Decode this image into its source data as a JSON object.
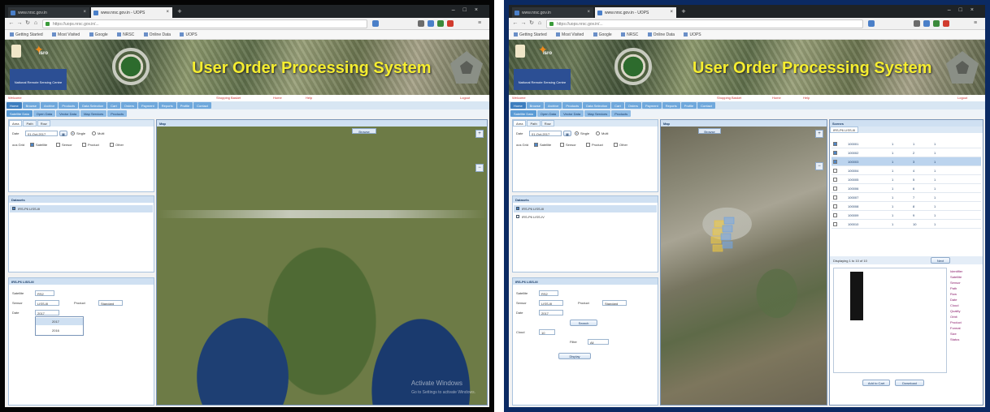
{
  "left": {
    "browser": {
      "tabs": [
        "www.nrsc.gov.in",
        "www.nrsc.gov.in - UOPS"
      ],
      "url": "https://uops.nrsc.gov.in/...",
      "bookmarks": [
        "Getting Started",
        "Most Visited",
        "Google",
        "NRSC",
        "Online Data",
        "UOPS"
      ]
    },
    "banner": {
      "logo_text": "isro",
      "sub": "National Remote Sensing Centre",
      "title": "User Order Processing System"
    },
    "infobar": {
      "user": "Welcome",
      "links": [
        "Shopping Basket",
        "Home",
        "Help",
        "Logout"
      ]
    },
    "menu": [
      "Home",
      "Browse",
      "Archive",
      "Products",
      "Data Selection",
      "Cart",
      "Orders",
      "Payment",
      "Reports",
      "Profile",
      "Contact"
    ],
    "submenu": [
      "Satellite Data",
      "Open Data",
      "Vector Data",
      "Map Services",
      "Products"
    ],
    "search": {
      "tabs": [
        "Area",
        "Path",
        "Row"
      ],
      "date_label": "Date",
      "date_value": "01-Oct-2017",
      "radio1": "Single",
      "radio2": "Multi",
      "opts": [
        "Satellite",
        "Sensor",
        "Product",
        "Other"
      ]
    },
    "tree": {
      "head": "Datasets",
      "items": [
        "IRS-P6 LISS-III"
      ]
    },
    "dataset": {
      "head": "IRS-P6 LISS-III",
      "satellite_label": "Satellite",
      "satellite_value": "RS2",
      "sensor_label": "Sensor",
      "sensor_value": "LISS-III",
      "product_label": "Product",
      "product_value": "Standard",
      "date_label": "Date",
      "date_value": "2017",
      "dropdown_opts": [
        "2017",
        "2016"
      ]
    },
    "map": {
      "head": "Map",
      "btn": "Browse",
      "watermark1": "Activate Windows",
      "watermark2": "Go to Settings to activate Windows."
    }
  },
  "right": {
    "browser": {
      "tabs": [
        "www.nrsc.gov.in",
        "www.nrsc.gov.in - UOPS"
      ],
      "url": "https://uops.nrsc.gov.in/...",
      "bookmarks": [
        "Getting Started",
        "Most Visited",
        "Google",
        "NRSC",
        "Online Data",
        "UOPS"
      ]
    },
    "banner": {
      "logo_text": "isro",
      "sub": "National Remote Sensing Centre",
      "title": "User Order Processing System"
    },
    "infobar": {
      "user": "Welcome",
      "links": [
        "Shopping Basket",
        "Home",
        "Help",
        "Logout"
      ]
    },
    "menu": [
      "Home",
      "Browse",
      "Archive",
      "Products",
      "Data Selection",
      "Cart",
      "Orders",
      "Payment",
      "Reports",
      "Profile",
      "Contact"
    ],
    "submenu": [
      "Satellite Data",
      "Open Data",
      "Vector Data",
      "Map Services",
      "Products"
    ],
    "search": {
      "tabs": [
        "Area",
        "Path",
        "Row"
      ],
      "date_label": "Date",
      "date_value": "01-Oct-2017",
      "radio1": "Single",
      "radio2": "Multi",
      "opts": [
        "Satellite",
        "Sensor",
        "Product",
        "Other"
      ]
    },
    "tree": {
      "head": "Datasets",
      "items": [
        "IRS-P6 LISS-III",
        "IRS-P6 LISS-IV"
      ]
    },
    "dataset": {
      "head": "IRS-P6 LISS-III",
      "satellite_label": "Satellite",
      "satellite_value": "RS2",
      "sensor_label": "Sensor",
      "sensor_value": "LISS-III",
      "product_label": "Product",
      "product_value": "Standard",
      "date_label": "Date",
      "date_value": "2017",
      "search_btn": "Search",
      "cloud_label": "Cloud",
      "cloud_value": "10",
      "filter_label": "Filter",
      "filter_value": "All",
      "show_btn": "Display"
    },
    "map": {
      "head": "Map",
      "btn": "Browse"
    },
    "results": {
      "head": "Scenes",
      "tab": "IRS-P6 LISS-III",
      "rows": [
        [
          "100001",
          "1",
          "1",
          "1"
        ],
        [
          "100002",
          "1",
          "2",
          "1"
        ],
        [
          "100003",
          "1",
          "3",
          "1"
        ],
        [
          "100004",
          "1",
          "4",
          "1"
        ],
        [
          "100005",
          "1",
          "5",
          "1"
        ],
        [
          "100006",
          "1",
          "6",
          "1"
        ],
        [
          "100007",
          "1",
          "7",
          "1"
        ],
        [
          "100008",
          "1",
          "8",
          "1"
        ],
        [
          "100009",
          "1",
          "9",
          "1"
        ],
        [
          "100010",
          "1",
          "10",
          "1"
        ]
      ],
      "pager": "Displaying 1 to 10 of 10",
      "next_btn": "Next",
      "links": [
        "Identifier",
        "Satellite",
        "Sensor",
        "Path",
        "Row",
        "Date",
        "Cloud",
        "Quality",
        "Orbit",
        "Product",
        "Format",
        "Size",
        "Status"
      ],
      "btn1": "Add to Cart",
      "btn2": "Download"
    }
  }
}
